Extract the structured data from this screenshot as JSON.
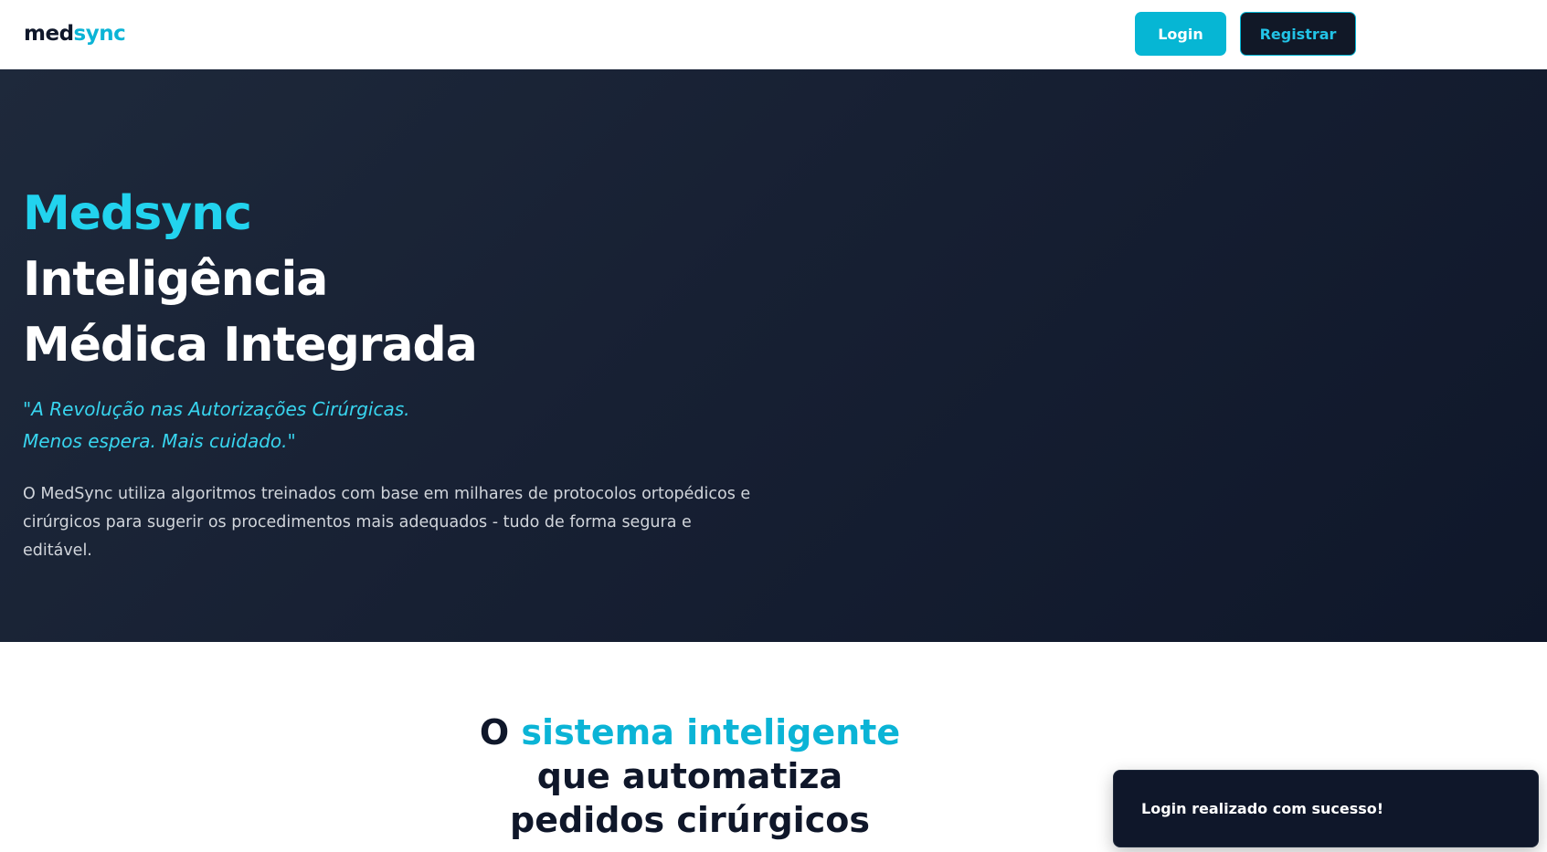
{
  "header": {
    "logo_part1": "med",
    "logo_part2": "sync",
    "login_label": "Login",
    "register_label": "Registrar"
  },
  "hero": {
    "brand": "Medsync",
    "title_line1": "Inteligência",
    "title_line2": "Médica Integrada",
    "quote_line1": "\"A Revolução nas Autorizações Cirúrgicas.",
    "quote_line2": "Menos espera. Mais cuidado.\"",
    "description": "O MedSync utiliza algoritmos treinados com base em milhares de protocolos ortopédicos e cirúrgicos para sugerir os procedimentos mais adequados - tudo de forma segura e editável."
  },
  "section": {
    "heading_prefix": "O ",
    "heading_accent": "sistema inteligente",
    "heading_line2": "que automatiza",
    "heading_line3": "pedidos cirúrgicos"
  },
  "toast": {
    "message": "Login realizado com sucesso!"
  },
  "colors": {
    "accent": "#06b6d4",
    "hero_bg": "#1e293b",
    "dark": "#0f172a"
  }
}
